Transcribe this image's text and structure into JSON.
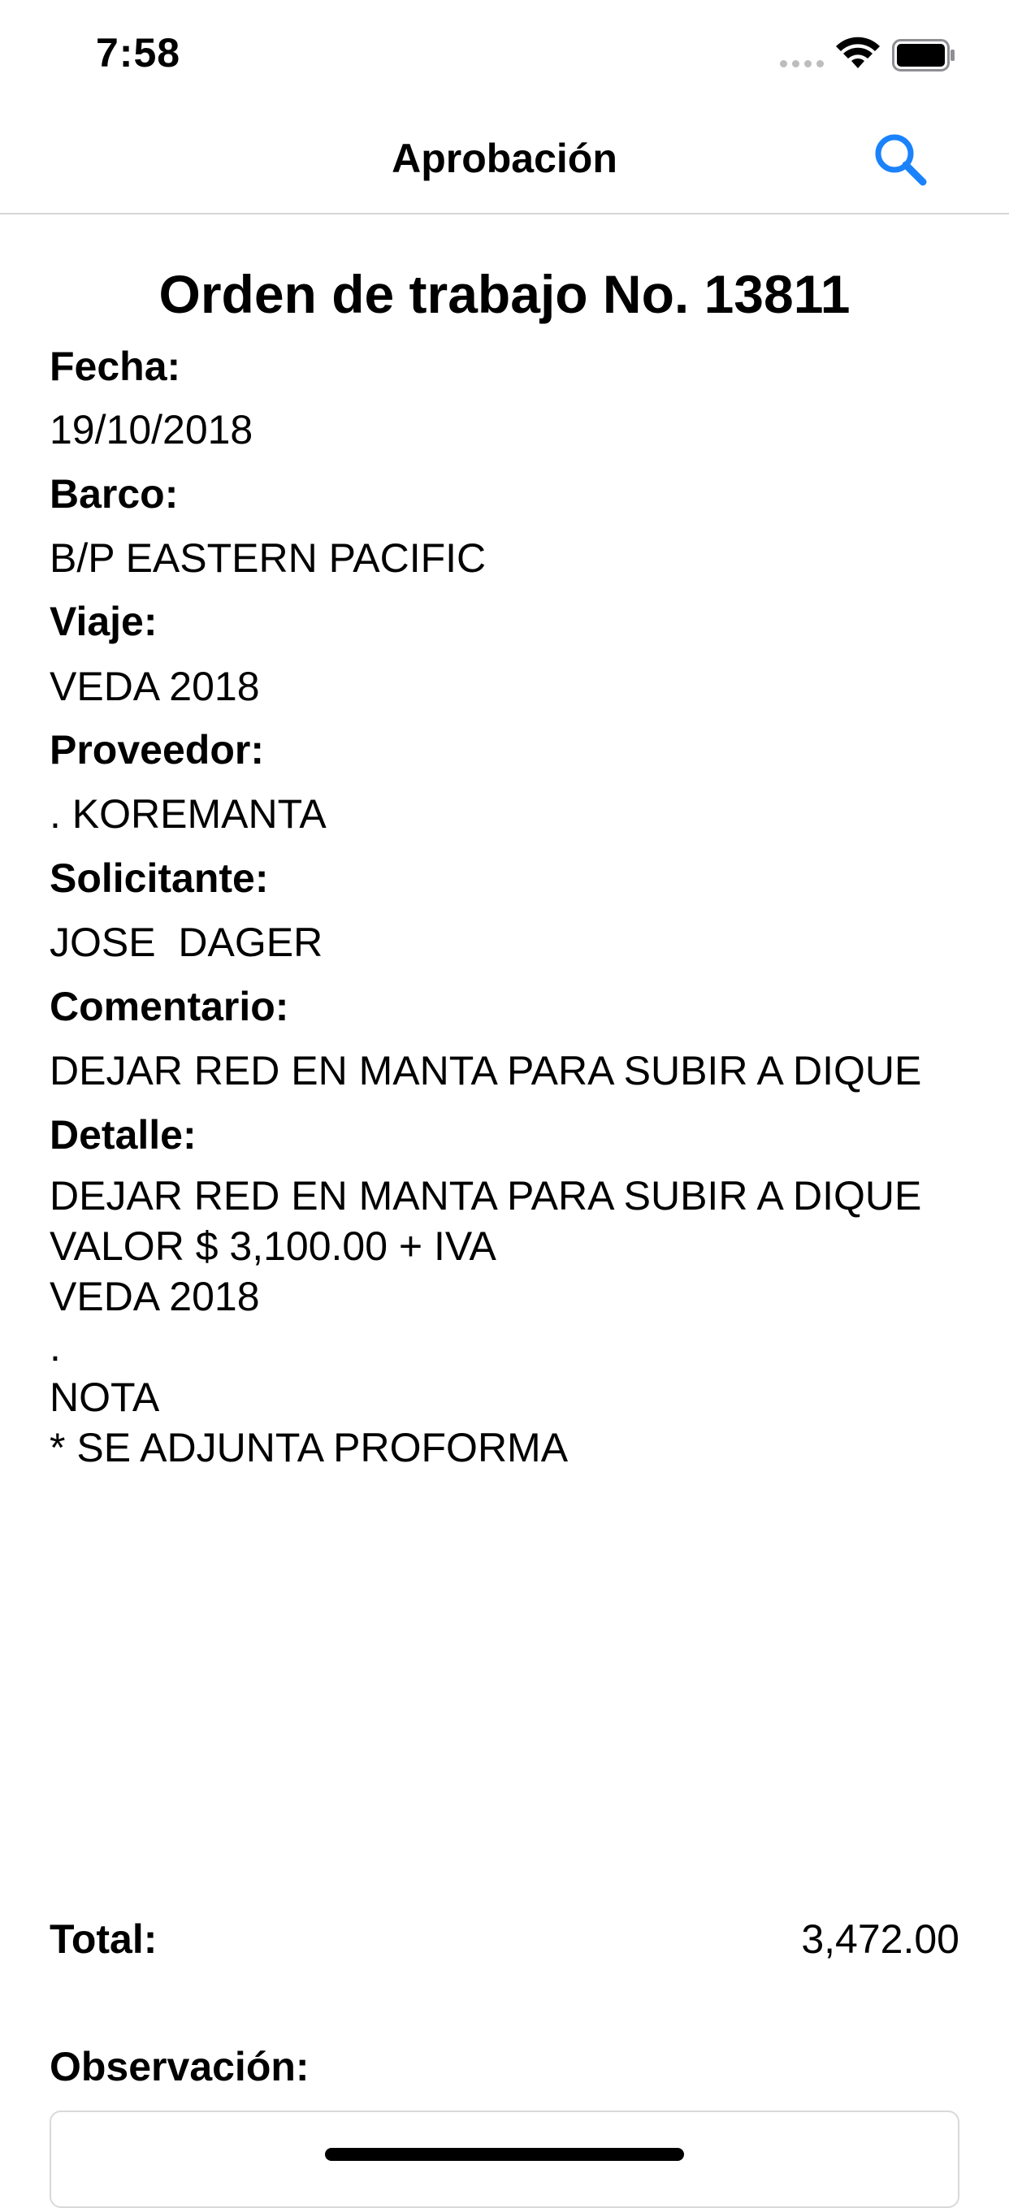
{
  "status_bar": {
    "time": "7:58",
    "icons": [
      "signal-dots-icon",
      "wifi-icon",
      "battery-icon"
    ]
  },
  "nav": {
    "title": "Aprobación",
    "search_icon": "search-icon",
    "accent_color": "#1a82fb"
  },
  "order": {
    "title": "Orden de trabajo No. 13811",
    "fields": [
      {
        "label": "Fecha:",
        "value": "19/10/2018"
      },
      {
        "label": "Barco:",
        "value": "B/P EASTERN PACIFIC"
      },
      {
        "label": "Viaje:",
        "value": "VEDA 2018"
      },
      {
        "label": "Proveedor:",
        "value": ". KOREMANTA"
      },
      {
        "label": "Solicitante:",
        "value": "JOSE  DAGER"
      },
      {
        "label": "Comentario:",
        "value": "DEJAR RED EN MANTA PARA SUBIR A DIQUE"
      }
    ],
    "detail": {
      "label": "Detalle:",
      "value": "DEJAR RED EN MANTA PARA SUBIR A DIQUE\nVALOR $  3,100.00 + IVA\nVEDA 2018\n.\nNOTA\n* SE ADJUNTA PROFORMA"
    },
    "total": {
      "label": "Total:",
      "value": "3,472.00"
    },
    "observation": {
      "label": "Observación:",
      "value": ""
    }
  }
}
